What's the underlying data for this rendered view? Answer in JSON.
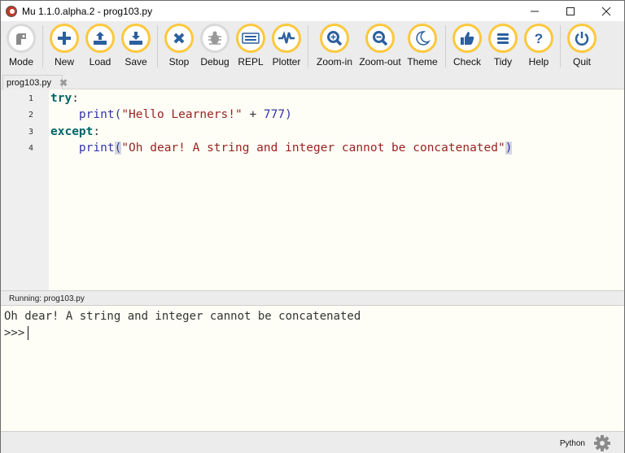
{
  "window": {
    "title": "Mu 1.1.0.alpha.2 - prog103.py",
    "controls": [
      "minimize",
      "maximize",
      "close"
    ]
  },
  "toolbar": {
    "buttons": [
      {
        "id": "mode",
        "label": "Mode",
        "icon": "mode-icon"
      },
      {
        "id": "new",
        "label": "New",
        "icon": "plus-icon"
      },
      {
        "id": "load",
        "label": "Load",
        "icon": "upload-icon"
      },
      {
        "id": "save",
        "label": "Save",
        "icon": "download-icon"
      },
      {
        "id": "stop",
        "label": "Stop",
        "icon": "x-icon"
      },
      {
        "id": "debug",
        "label": "Debug",
        "icon": "bug-icon"
      },
      {
        "id": "repl",
        "label": "REPL",
        "icon": "keyboard-icon"
      },
      {
        "id": "plotter",
        "label": "Plotter",
        "icon": "pulse-icon"
      },
      {
        "id": "zoom-in",
        "label": "Zoom-in",
        "icon": "zoom-in-icon"
      },
      {
        "id": "zoom-out",
        "label": "Zoom-out",
        "icon": "zoom-out-icon"
      },
      {
        "id": "theme",
        "label": "Theme",
        "icon": "moon-icon"
      },
      {
        "id": "check",
        "label": "Check",
        "icon": "thumbs-up-icon"
      },
      {
        "id": "tidy",
        "label": "Tidy",
        "icon": "lines-icon"
      },
      {
        "id": "help",
        "label": "Help",
        "icon": "question-icon"
      },
      {
        "id": "quit",
        "label": "Quit",
        "icon": "power-icon"
      }
    ]
  },
  "tabs": [
    {
      "label": "prog103.py",
      "close": "✖"
    }
  ],
  "editor": {
    "lines": [
      {
        "n": "1",
        "code": "try:"
      },
      {
        "n": "2",
        "code": "    print(\"Hello Learners!\" + 777)"
      },
      {
        "n": "3",
        "code": "except:"
      },
      {
        "n": "4",
        "code": "    print(\"Oh dear! A string and integer cannot be concatenated\")"
      }
    ],
    "tokens": {
      "l1_kw": "try",
      "l1_colon": ":",
      "l2_indent": "    ",
      "l2_fn": "print",
      "l2_open": "(",
      "l2_str": "\"Hello Learners!\"",
      "l2_op": " + ",
      "l2_num": "777",
      "l2_close": ")",
      "l3_kw": "except",
      "l3_colon": ":",
      "l4_indent": "    ",
      "l4_fn": "print",
      "l4_open": "(",
      "l4_str": "\"Oh dear! A string and integer cannot be concatenated\"",
      "l4_close": ")"
    }
  },
  "runner": {
    "label": "Running: prog103.py",
    "output": "Oh dear! A string and integer cannot be concatenated",
    "prompt": ">>>"
  },
  "status": {
    "mode": "Python"
  },
  "colors": {
    "accent_ring": "#fcc83d",
    "icon_blue": "#2c5f9e",
    "icon_grey": "#888888"
  }
}
